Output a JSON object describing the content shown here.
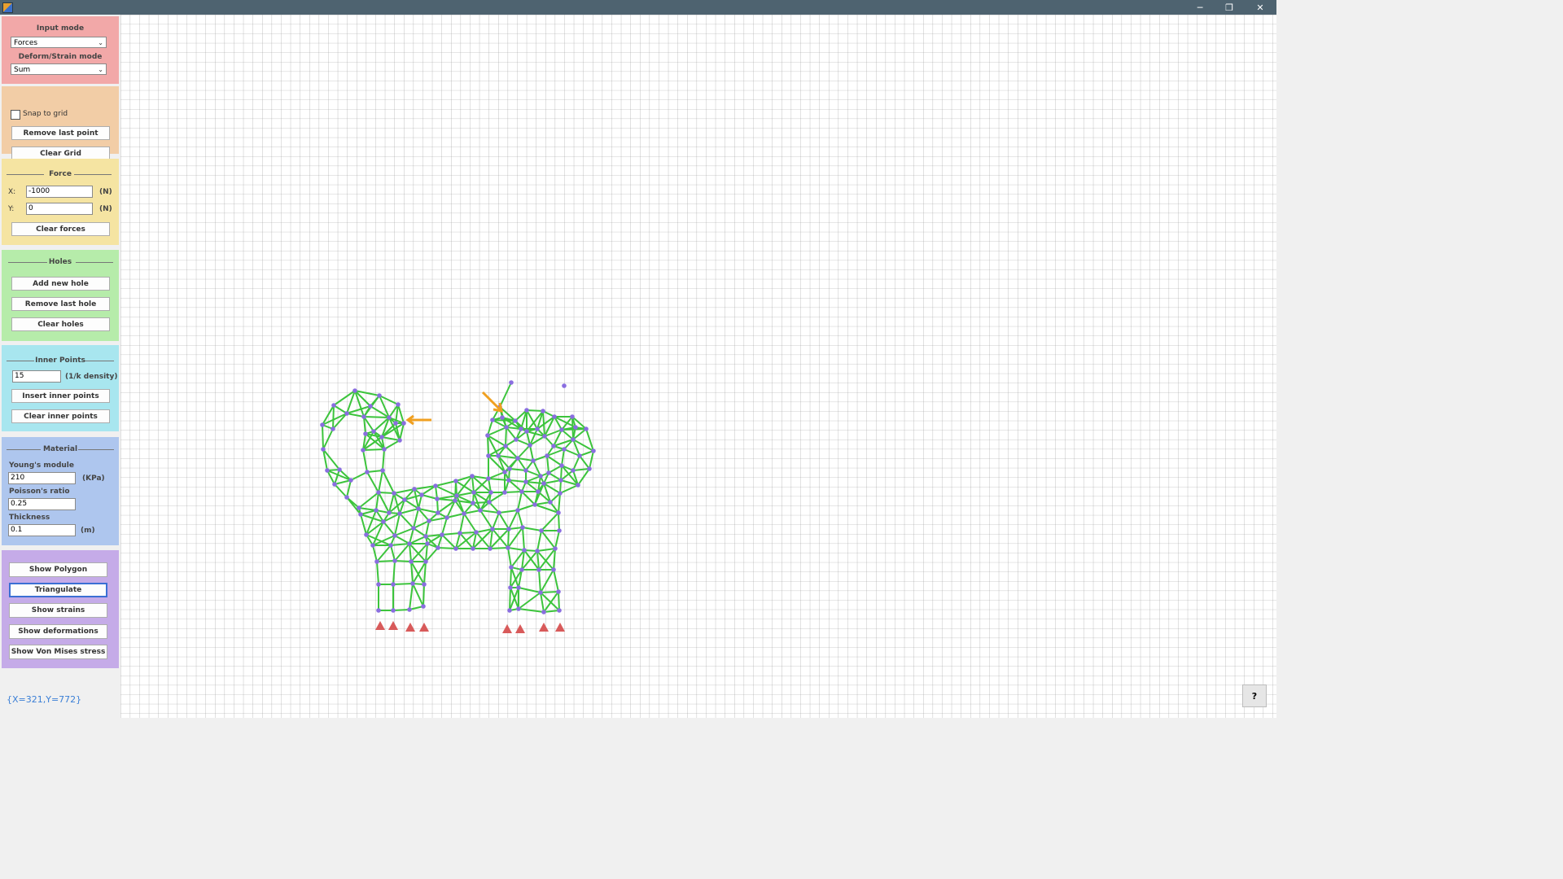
{
  "window": {
    "minimize": "─",
    "maximize": "❐",
    "close": "✕"
  },
  "input_panel": {
    "input_mode_label": "Input mode",
    "input_mode_value": "Forces",
    "deform_mode_label": "Deform/Strain mode",
    "deform_mode_value": "Sum"
  },
  "grid_panel": {
    "snap_label": "Snap to grid",
    "snap_checked": false,
    "remove_last_point": "Remove last point",
    "clear_grid": "Clear Grid"
  },
  "force_panel": {
    "title": "Force",
    "x_label": "X:",
    "x_value": "-1000",
    "x_unit": "(N)",
    "y_label": "Y:",
    "y_value": "0",
    "y_unit": "(N)",
    "clear_forces": "Clear forces"
  },
  "holes_panel": {
    "title": "Holes",
    "add_new_hole": "Add new hole",
    "remove_last_hole": "Remove last hole",
    "clear_holes": "Clear holes"
  },
  "inner_panel": {
    "title": "Inner Points",
    "density_value": "15",
    "density_unit": "(1/k density)",
    "insert_inner_points": "Insert inner points",
    "clear_inner_points": "Clear inner points"
  },
  "material_panel": {
    "title": "Material",
    "youngs_label": "Young's module",
    "youngs_value": "210",
    "youngs_unit": "(KPa)",
    "poisson_label": "Poisson's ratio",
    "poisson_value": "0.25",
    "thickness_label": "Thickness",
    "thickness_value": "0.1",
    "thickness_unit": "(m)"
  },
  "actions": {
    "show_polygon": "Show Polygon",
    "triangulate": "Triangulate",
    "show_strains": "Show strains",
    "show_deformations": "Show deformations",
    "show_von_mises": "Show Von Mises stress"
  },
  "status": {
    "coords": "{X=321,Y=772}"
  },
  "help_button": "?",
  "colors": {
    "titlebar": "#4e6370",
    "mesh_edge": "#3cc43c",
    "mesh_node": "#8a6ee0",
    "support": "#d85a5a",
    "force_arrow": "#f0a020",
    "grid_line": "#9a9a9a"
  },
  "icons": {
    "app": "app-icon",
    "dropdown": "chevron-down-icon",
    "support": "triangle-support-icon",
    "force": "arrow-icon"
  }
}
